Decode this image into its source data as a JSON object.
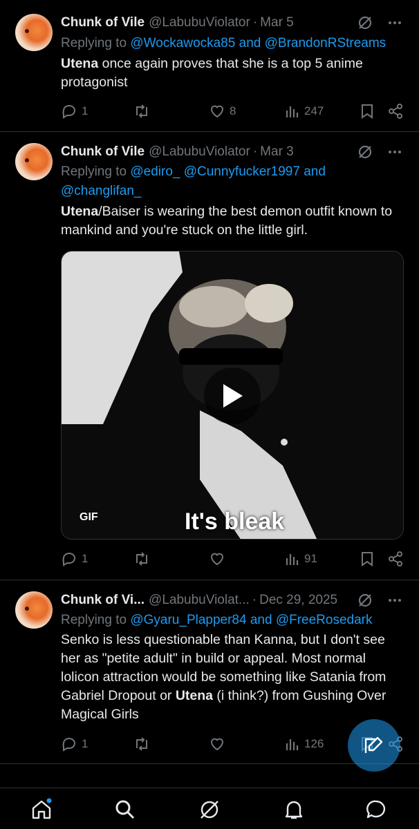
{
  "tweets": [
    {
      "name": "Chunk of Vile",
      "handle": "@LabubuViolator",
      "sep": "·",
      "date": "Mar 5",
      "reply_prefix": "Replying to ",
      "reply_mentions": "@Wockawocka85 and @BrandonRStreams",
      "text_bold": "Utena",
      "text_rest": " once again proves that she is a top 5 anime protagonist",
      "replies": "1",
      "reposts": "",
      "likes": "8",
      "views": "247"
    },
    {
      "name": "Chunk of Vile",
      "handle": "@LabubuViolator",
      "sep": "·",
      "date": "Mar 3",
      "reply_prefix": "Replying to ",
      "reply_mentions": "@ediro_ @Cunnyfucker1997 and @changlifan_",
      "text_bold": "Utena",
      "text_rest": "/Baiser is wearing the best demon outfit known to mankind and you're stuck on the little girl.",
      "media_badge": "GIF",
      "media_caption": "It's bleak",
      "replies": "1",
      "reposts": "",
      "likes": "",
      "views": "91"
    },
    {
      "name": "Chunk of Vi...",
      "handle": "@LabubuViolat...",
      "sep": "·",
      "date": "Dec 29, 2025",
      "reply_prefix": "Replying to ",
      "reply_mentions": "@Gyaru_Plapper84 and @FreeRosedark",
      "text_part1": "Senko is less questionable than Kanna, but I don't see her as \"petite adult\" in build or appeal. Most normal lolicon attraction would be something like Satania from Gabriel Dropout or ",
      "text_bold": "Utena",
      "text_part2": " (i think?) from Gushing Over Magical Girls",
      "replies": "1",
      "reposts": "",
      "likes": "",
      "views": "126"
    }
  ],
  "icons": {
    "grok": "grok-icon",
    "more": "more-icon",
    "reply": "reply-icon",
    "repost": "repost-icon",
    "like": "like-icon",
    "views": "views-icon",
    "bookmark": "bookmark-icon",
    "share": "share-icon",
    "compose": "compose-icon",
    "home": "home-icon",
    "search": "search-icon",
    "notifications": "notifications-icon",
    "messages": "messages-icon"
  },
  "colors": {
    "accent": "#1d9bf0",
    "muted": "#71767b",
    "text": "#e7e9ea",
    "bg": "#000000"
  }
}
